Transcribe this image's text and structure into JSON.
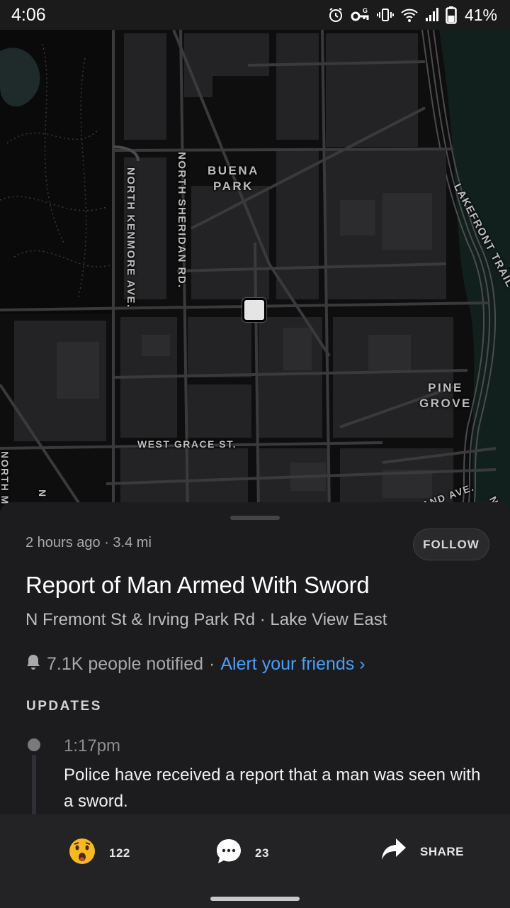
{
  "status_bar": {
    "time": "4:06",
    "battery_percent": "41%",
    "icons": [
      "alarm-icon",
      "vpn-key-icon",
      "vibrate-icon",
      "wifi-icon",
      "cell-signal-icon",
      "battery-icon"
    ]
  },
  "map": {
    "labels": {
      "buena_park_line1": "BUENA",
      "buena_park_line2": "PARK",
      "north_kenmore": "NORTH KENMORE AVE.",
      "north_sheridan": "NORTH SHERIDAN RD.",
      "lakefront_trail": "LAKEFRONT TRAIL",
      "pine_grove_line1": "PINE",
      "pine_grove_line2": "GROVE",
      "west_grace": "WEST GRACE ST.",
      "cleland_ave": "ELAND AVE.",
      "north_m": "NORTH M",
      "n_partial_1": "N",
      "n_partial_2": "N"
    },
    "colors": {
      "background": "#0e0e0f",
      "road": "#3a3a3c",
      "major_road": "#4a4a4c",
      "building": "#232325",
      "park_outline": "#3d3d3d",
      "water": "#1f2a2a"
    }
  },
  "incident": {
    "time_ago": "2 hours ago",
    "distance": "3.4 mi",
    "separator": " · ",
    "follow_label": "FOLLOW",
    "title": "Report of Man Armed With Sword",
    "location": "N Fremont St & Irving Park Rd · Lake View East",
    "notified": "7.1K people notified",
    "notify_separator": " · ",
    "alert_link": "Alert your friends ›"
  },
  "updates": {
    "heading": "UPDATES",
    "items": [
      {
        "time": "1:17pm",
        "text": "Police have received a report that a man was seen with a sword."
      }
    ]
  },
  "actions": {
    "reactions_count": "122",
    "comments_count": "23",
    "share_label": "SHARE"
  },
  "colors": {
    "sheet_bg": "#1c1c1e",
    "action_bar_bg": "#232325",
    "link_blue": "#4a9ff5",
    "secondary_text": "#a8a8a8",
    "emoji_yellow": "#f6b91f"
  }
}
